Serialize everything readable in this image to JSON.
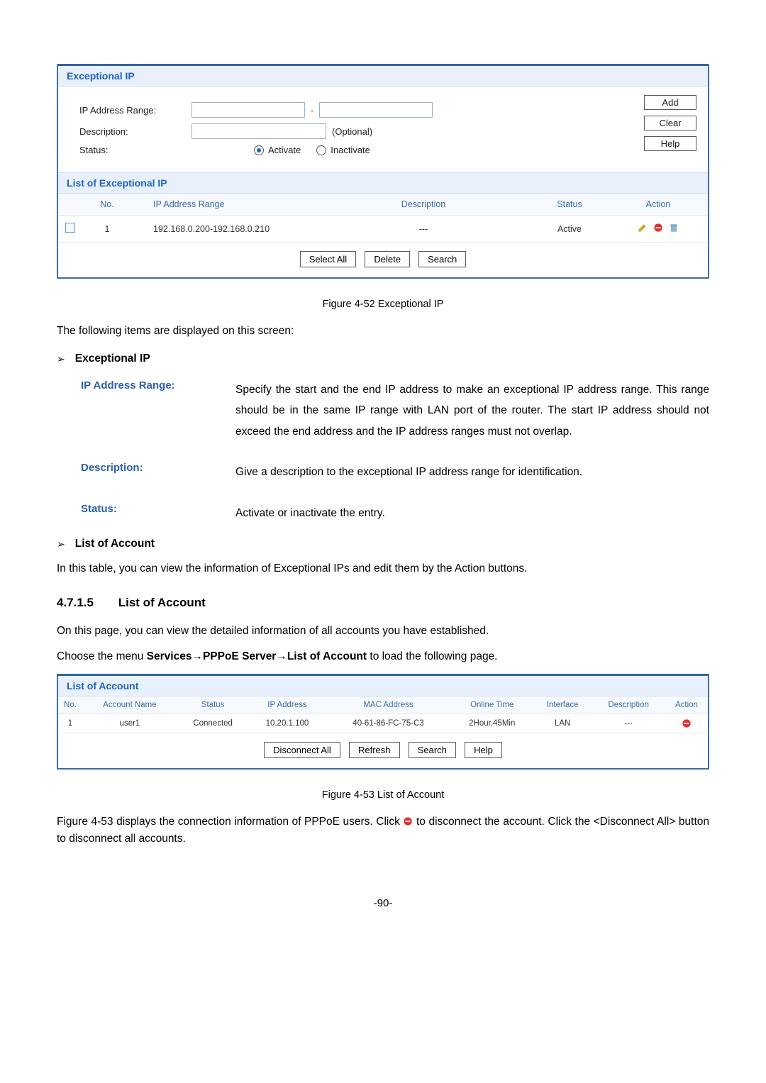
{
  "panel1": {
    "title": "Exceptional IP",
    "fields": {
      "ip_range_label": "IP Address Range:",
      "ip_sep": "-",
      "description_label": "Description:",
      "optional_hint": "(Optional)",
      "status_label": "Status:",
      "activate_label": "Activate",
      "inactivate_label": "Inactivate"
    },
    "buttons": {
      "add": "Add",
      "clear": "Clear",
      "help": "Help"
    },
    "list_title": "List of Exceptional IP",
    "headers": {
      "no": "No.",
      "range": "IP Address Range",
      "desc": "Description",
      "status": "Status",
      "action": "Action"
    },
    "rows": [
      {
        "no": "1",
        "range": "192.168.0.200-192.168.0.210",
        "desc": "---",
        "status": "Active"
      }
    ],
    "footer_buttons": {
      "select_all": "Select All",
      "delete": "Delete",
      "search": "Search"
    }
  },
  "caption1": "Figure 4-52 Exceptional IP",
  "intro1": "The following items are displayed on this screen:",
  "chevron1": "Exceptional IP",
  "defs": {
    "ip_range_term": "IP Address Range:",
    "ip_range_desc": "Specify the start and the end IP address to make an exceptional IP address range. This range should be in the same IP range with LAN port of the router. The start IP address should not exceed the end address and the IP address ranges must not overlap.",
    "description_term": "Description:",
    "description_desc": "Give a description to the exceptional IP address range for identification.",
    "status_term": "Status:",
    "status_desc": "Activate or inactivate the entry."
  },
  "chevron2": "List of Account",
  "list_desc_text": "In this table, you can view the information of Exceptional IPs and edit them by the Action buttons.",
  "section": {
    "num": "4.7.1.5",
    "title": "List of Account"
  },
  "section_p1": "On this page, you can view the detailed information of all accounts you have established.",
  "menu_line_pre": "Choose the menu ",
  "menu_line_bold": "Services→PPPoE Server→List of Account",
  "menu_line_post": " to load the following page.",
  "panel2": {
    "title": "List of Account",
    "headers": {
      "no": "No.",
      "acct": "Account Name",
      "status": "Status",
      "ip": "IP Address",
      "mac": "MAC Address",
      "online": "Online Time",
      "iface": "Interface",
      "desc": "Description",
      "action": "Action"
    },
    "rows": [
      {
        "no": "1",
        "acct": "user1",
        "status": "Connected",
        "ip": "10.20.1.100",
        "mac": "40-61-86-FC-75-C3",
        "online": "2Hour,45Min",
        "iface": "LAN",
        "desc": "---"
      }
    ],
    "footer_buttons": {
      "disconnect_all": "Disconnect All",
      "refresh": "Refresh",
      "search": "Search",
      "help": "Help"
    }
  },
  "caption2": "Figure 4-53 List of Account",
  "tail_pre": "Figure 4-53 displays the connection information of PPPoE users. Click ",
  "tail_post": " to disconnect the account. Click the <Disconnect All> button to disconnect all accounts.",
  "page_number": "-90-"
}
